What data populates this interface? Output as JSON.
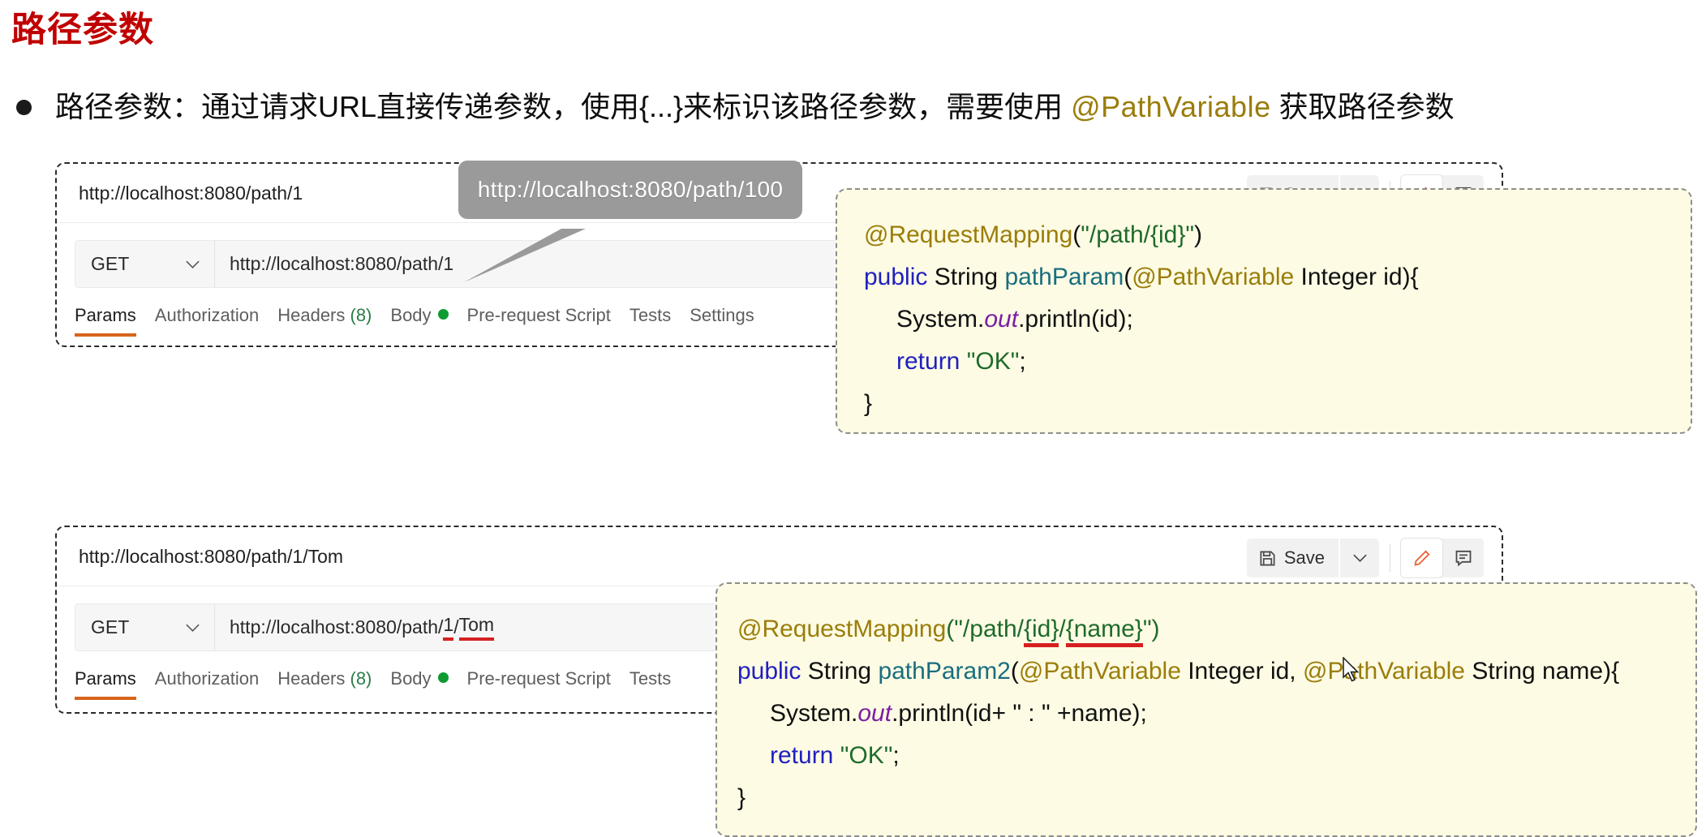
{
  "slide": {
    "title": "路径参数",
    "bullet": {
      "prefix": "路径参数：通过请求URL直接传递参数，使用{...}来标识该路径参数，需要使用 ",
      "highlight": "@PathVariable",
      "suffix": " 获取路径参数"
    }
  },
  "callout": {
    "text": "http://localhost:8080/path/100"
  },
  "panel_top": {
    "request_name": "http://localhost:8080/path/1",
    "save_label": "Save",
    "method": "GET",
    "url": "http://localhost:8080/path/1",
    "tabs": [
      {
        "label": "Params",
        "active": true
      },
      {
        "label": "Authorization",
        "active": false
      },
      {
        "label": "Headers",
        "count": "(8)",
        "active": false
      },
      {
        "label": "Body",
        "dot": true,
        "active": false
      },
      {
        "label": "Pre-request Script",
        "active": false
      },
      {
        "label": "Tests",
        "active": false
      },
      {
        "label": "Settings",
        "active": false
      }
    ]
  },
  "panel_bottom": {
    "request_name": "http://localhost:8080/path/1/Tom",
    "save_label": "Save",
    "method": "GET",
    "url_plain": "http://localhost:8080/path/",
    "url_id": "1",
    "url_sep": "/",
    "url_name": "Tom",
    "tabs": [
      {
        "label": "Params",
        "active": true
      },
      {
        "label": "Authorization",
        "active": false
      },
      {
        "label": "Headers",
        "count": "(8)",
        "active": false
      },
      {
        "label": "Body",
        "dot": true,
        "active": false
      },
      {
        "label": "Pre-request Script",
        "active": false
      },
      {
        "label": "Tests",
        "active": false
      }
    ]
  },
  "code_top": {
    "l1_ann": "@RequestMapping",
    "l1_open": "(",
    "l1_str": "\"/path/{id}\"",
    "l1_close": ")",
    "l2_kw": "public",
    "l2_type": " String ",
    "l2_method": "pathParam",
    "l2_paren": "(",
    "l2_ann": "@PathVariable",
    "l2_args": " Integer id){",
    "l3_a": "System.",
    "l3_field": "out",
    "l3_b": ".println(id);",
    "l4_kw": "return ",
    "l4_str": "\"OK\"",
    "l4_semi": ";",
    "l5": "}"
  },
  "code_bottom": {
    "l1_ann": "@RequestMapping",
    "l1_open": "(\"/path/",
    "l1_id": "{id}",
    "l1_slash": "/",
    "l1_name": "{name}",
    "l1_close": "\")",
    "l2_kw": "public",
    "l2_type": " String ",
    "l2_method": "pathParam2",
    "l2_paren": "(",
    "l2_ann1": "@PathVariable",
    "l2_mid": " Integer id, ",
    "l2_ann2": "@PathVariable",
    "l2_args": " String name){",
    "l3_a": "System.",
    "l3_field": "out",
    "l3_b": ".println(id+ \" : \" +name);",
    "l4_kw": "return ",
    "l4_str": "\"OK\"",
    "l4_semi": ";",
    "l5": "}"
  },
  "colors": {
    "title_red": "#C00000",
    "annotation_gold": "#9A7D0A",
    "string_green": "#1e6b2b",
    "keyword_blue": "#2020C0",
    "method_teal": "#1A6E7E",
    "field_purple": "#7b1fa2",
    "underline_red": "#d62020",
    "tab_accent": "#d7651c",
    "code_bg": "#FDFBE4",
    "callout_gray": "#9a9a9a"
  }
}
